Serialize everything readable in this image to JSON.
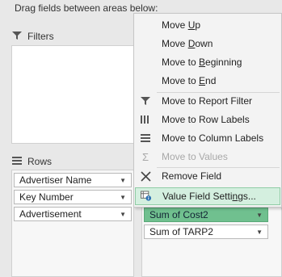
{
  "instruction": "Drag fields between areas below:",
  "filters": {
    "label": "Filters"
  },
  "rows": {
    "label": "Rows",
    "fields": [
      {
        "name": "Advertiser Name"
      },
      {
        "name": "Key Number"
      },
      {
        "name": "Advertisement"
      }
    ]
  },
  "values": {
    "fields": [
      {
        "name": "Sum of Cost2",
        "active": true
      },
      {
        "name": "Sum of TARP2",
        "active": false
      }
    ]
  },
  "menu": {
    "items": [
      {
        "pre": "Move ",
        "key": "U",
        "post": "p",
        "icon": "",
        "disabled": false
      },
      {
        "pre": "Move ",
        "key": "D",
        "post": "own",
        "icon": "",
        "disabled": false
      },
      {
        "pre": "Move to ",
        "key": "B",
        "post": "eginning",
        "icon": "",
        "disabled": false
      },
      {
        "pre": "Move to ",
        "key": "E",
        "post": "nd",
        "icon": "",
        "disabled": false
      },
      {
        "pre": "Move to Report Filter",
        "key": "",
        "post": "",
        "icon": "filter-icon",
        "disabled": false
      },
      {
        "pre": "Move to Row Labels",
        "key": "",
        "post": "",
        "icon": "row-labels-icon",
        "disabled": false
      },
      {
        "pre": "Move to Column Labels",
        "key": "",
        "post": "",
        "icon": "column-labels-icon",
        "disabled": false
      },
      {
        "pre": "Move to Values",
        "key": "",
        "post": "",
        "icon": "sigma-icon",
        "disabled": true
      },
      {
        "pre": "Remove Field",
        "key": "",
        "post": "",
        "icon": "remove-icon",
        "disabled": false
      },
      {
        "pre": "Value Field Setti",
        "key": "n",
        "post": "gs...",
        "icon": "value-settings-icon",
        "disabled": false
      }
    ]
  }
}
